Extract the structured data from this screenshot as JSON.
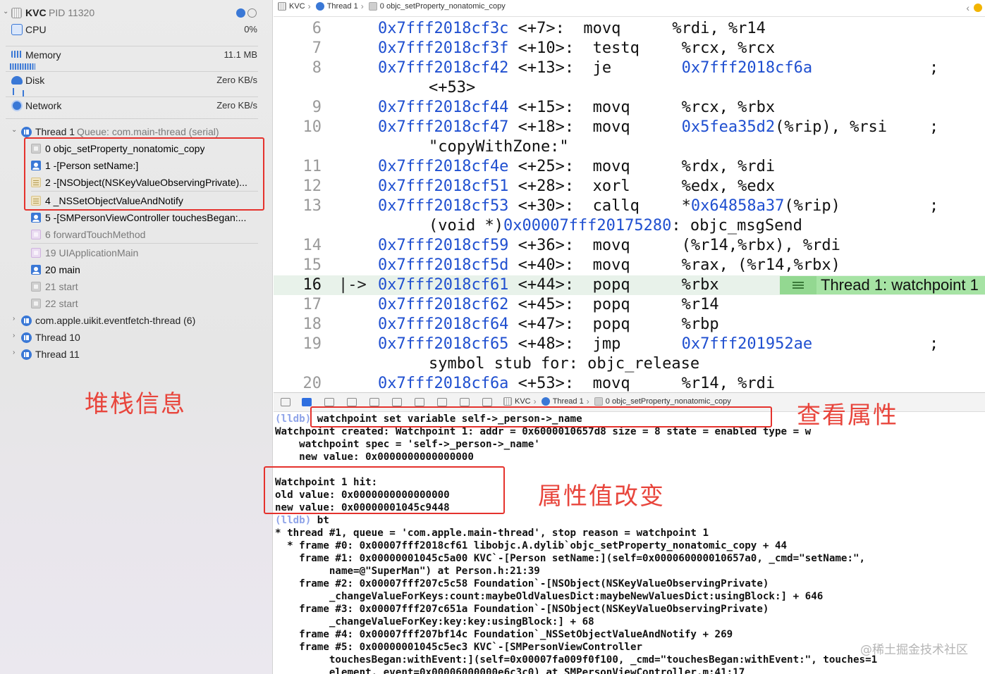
{
  "colors": {
    "accent": "#3a78d6",
    "annotation": "#e5322d",
    "address": "#1f4fd0",
    "string": "#c41a16",
    "watchpoint_badge": "#a6e3a4"
  },
  "navigator": {
    "process": "KVC",
    "pid": "PID 11320",
    "gauges": [
      {
        "label": "CPU",
        "value": "0%"
      },
      {
        "label": "Memory",
        "value": "11.1 MB"
      },
      {
        "label": "Disk",
        "value": "Zero KB/s"
      },
      {
        "label": "Network",
        "value": "Zero KB/s"
      }
    ],
    "thread1": {
      "name": "Thread 1",
      "queue": "Queue: com.main-thread (serial)"
    },
    "frames": [
      {
        "text": "0 objc_setProperty_nonatomic_copy",
        "icon": "system-frame-icon"
      },
      {
        "text": "1 -[Person setName:]",
        "icon": "user-frame-icon"
      },
      {
        "text": "2 -[NSObject(NSKeyValueObservingPrivate)...",
        "icon": "framework-frame-icon"
      },
      {
        "text": "4 _NSSetObjectValueAndNotify",
        "icon": "framework-frame-icon"
      },
      {
        "text": "5 -[SMPersonViewController touchesBegan:...",
        "icon": "user-frame-icon"
      },
      {
        "text": "6 forwardTouchMethod",
        "icon": "ui-frame-icon"
      },
      {
        "text": "19 UIApplicationMain",
        "icon": "ui-frame-icon"
      },
      {
        "text": "20 main",
        "icon": "user-frame-icon"
      },
      {
        "text": "21 start",
        "icon": "system-frame-icon"
      },
      {
        "text": "22 start",
        "icon": "system-frame-icon"
      }
    ],
    "other_threads": [
      "com.apple.uikit.eventfetch-thread (6)",
      "Thread 10",
      "Thread 11"
    ]
  },
  "annotations": {
    "stack": "堆栈信息",
    "view_property": "查看属性",
    "value_changed": "属性值改变"
  },
  "breadcrumb": {
    "app": "KVC",
    "thread": "Thread 1",
    "frame": "0 objc_setProperty_nonatomic_copy"
  },
  "disassembly": [
    {
      "ln": "6",
      "addr": "0x7fff2018cf3c",
      "off": " <+7>:",
      "op": "movq",
      "args": "%rdi, %r14"
    },
    {
      "ln": "7",
      "addr": "0x7fff2018cf3f",
      "off": " <+10>:",
      "op": "testq",
      "args": "%rcx, %rcx"
    },
    {
      "ln": "8",
      "addr": "0x7fff2018cf42",
      "off": " <+13>:",
      "op": "je",
      "target": "0x7fff2018cf6a",
      "semi": ";"
    },
    {
      "cont": "<+53>"
    },
    {
      "ln": "9",
      "addr": "0x7fff2018cf44",
      "off": " <+15>:",
      "op": "movq",
      "args": "%rcx, %rbx"
    },
    {
      "ln": "10",
      "addr": "0x7fff2018cf47",
      "off": " <+18>:",
      "op": "movq",
      "target": "0x5fea35d2",
      "args2": "(%rip), %rsi",
      "semi": ";"
    },
    {
      "cont_str": "\"copyWithZone:\""
    },
    {
      "ln": "11",
      "addr": "0x7fff2018cf4e",
      "off": " <+25>:",
      "op": "movq",
      "args": "%rdx, %rdi"
    },
    {
      "ln": "12",
      "addr": "0x7fff2018cf51",
      "off": " <+28>:",
      "op": "xorl",
      "args": "%edx, %edx"
    },
    {
      "ln": "13",
      "addr": "0x7fff2018cf53",
      "off": " <+30>:",
      "op": "callq",
      "args": "*",
      "target": "0x64858a37",
      "args2": "(%rip)",
      "semi": ";"
    },
    {
      "cont_mix": [
        "(void *)",
        "0x00007fff20175280",
        ": objc_msgSend"
      ]
    },
    {
      "ln": "14",
      "addr": "0x7fff2018cf59",
      "off": " <+36>:",
      "op": "movq",
      "args": "(%r14,%rbx), %rdi"
    },
    {
      "ln": "15",
      "addr": "0x7fff2018cf5d",
      "off": " <+40>:",
      "op": "movq",
      "args": "%rax, (%r14,%rbx)"
    },
    {
      "ln": "16",
      "addr": "0x7fff2018cf61",
      "off": " <+44>:",
      "op": "popq",
      "args": "%rbx",
      "current": true
    },
    {
      "ln": "17",
      "addr": "0x7fff2018cf62",
      "off": " <+45>:",
      "op": "popq",
      "args": "%r14"
    },
    {
      "ln": "18",
      "addr": "0x7fff2018cf64",
      "off": " <+47>:",
      "op": "popq",
      "args": "%rbp"
    },
    {
      "ln": "19",
      "addr": "0x7fff2018cf65",
      "off": " <+48>:",
      "op": "jmp",
      "target": "0x7fff201952ae",
      "semi": ";"
    },
    {
      "cont": "symbol stub for: objc_release"
    },
    {
      "ln": "20",
      "addr": "0x7fff2018cf6a",
      "off": " <+53>:",
      "op": "movq",
      "args": "%r14, %rdi"
    }
  ],
  "current_marker": "|->",
  "watchpoint_badge": "Thread 1: watchpoint 1",
  "console": {
    "prompt": "(lldb)",
    "lines": [
      {
        "p": true,
        "t": " watchpoint set variable self->_person->_name"
      },
      {
        "t": "Watchpoint created: Watchpoint 1: addr = 0x6000010657d8 size = 8 state = enabled type = w"
      },
      {
        "t": "    watchpoint spec = 'self->_person->_name'"
      },
      {
        "t": "    new value: 0x0000000000000000"
      },
      {
        "t": ""
      },
      {
        "t": "Watchpoint 1 hit:"
      },
      {
        "t": "old value: 0x0000000000000000"
      },
      {
        "t": "new value: 0x00000001045c9448"
      },
      {
        "p": true,
        "t": " bt"
      },
      {
        "t": "* thread #1, queue = 'com.apple.main-thread', stop reason = watchpoint 1"
      },
      {
        "t": "  * frame #0: 0x00007fff2018cf61 libobjc.A.dylib`objc_setProperty_nonatomic_copy + 44"
      },
      {
        "t": "    frame #1: 0x00000001045c5a00 KVC`-[Person setName:](self=0x000060000010657a0, _cmd=\"setName:\","
      },
      {
        "t": "         name=@\"SuperMan\") at Person.h:21:39"
      },
      {
        "t": "    frame #2: 0x00007fff207c5c58 Foundation`-[NSObject(NSKeyValueObservingPrivate)"
      },
      {
        "t": "         _changeValueForKeys:count:maybeOldValuesDict:maybeNewValuesDict:usingBlock:] + 646"
      },
      {
        "t": "    frame #3: 0x00007fff207c651a Foundation`-[NSObject(NSKeyValueObservingPrivate)"
      },
      {
        "t": "         _changeValueForKey:key:key:usingBlock:] + 68"
      },
      {
        "t": "    frame #4: 0x00007fff207bf14c Foundation`_NSSetObjectValueAndNotify + 269"
      },
      {
        "t": "    frame #5: 0x00000001045c5ec3 KVC`-[SMPersonViewController"
      },
      {
        "t": "         touchesBegan:withEvent:](self=0x00007fa009f0f100, _cmd=\"touchesBegan:withEvent:\", touches=1"
      },
      {
        "t": "         element, event=0x00006000000e6c3c0) at SMPersonViewController.m:41:17"
      }
    ]
  },
  "watermark": "@稀土掘金技术社区"
}
